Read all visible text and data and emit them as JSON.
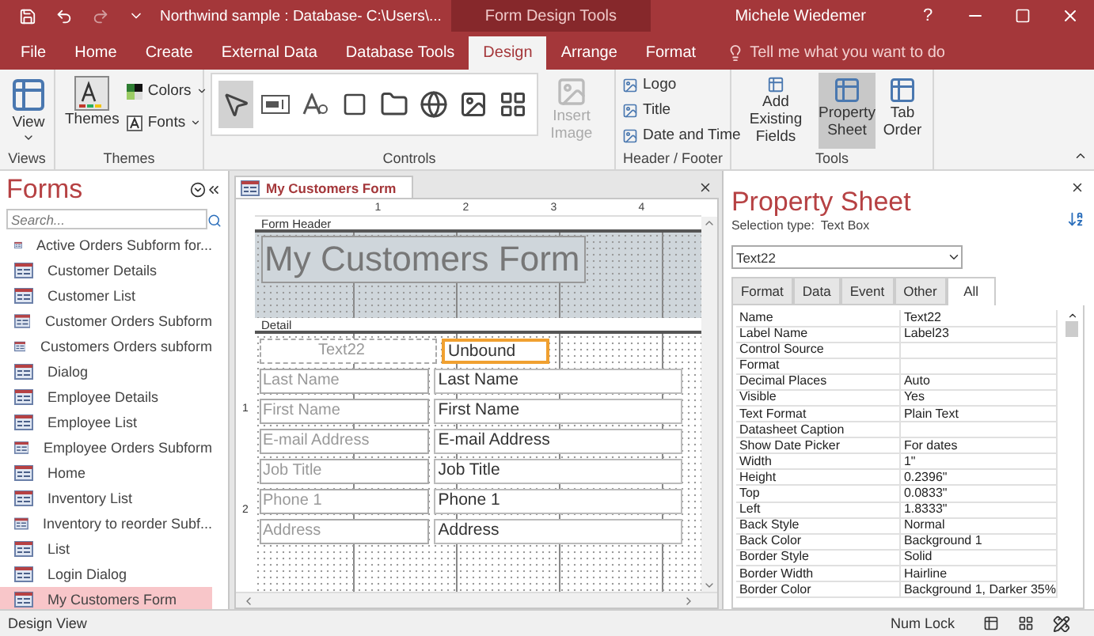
{
  "window": {
    "title": "Northwind sample : Database- C:\\Users\\...",
    "context_title": "Form Design Tools",
    "user": "Michele Wiedemer",
    "help": "?"
  },
  "ribbon_tabs": [
    {
      "label": "File",
      "selected": false
    },
    {
      "label": "Home",
      "selected": false
    },
    {
      "label": "Create",
      "selected": false
    },
    {
      "label": "External Data",
      "selected": false
    },
    {
      "label": "Database Tools",
      "selected": false
    },
    {
      "label": "Design",
      "selected": true
    },
    {
      "label": "Arrange",
      "selected": false
    },
    {
      "label": "Format",
      "selected": false
    }
  ],
  "tell_me": {
    "placeholder": "Tell me what you want to do"
  },
  "ribbon": {
    "views": {
      "label": "Views",
      "button": "View"
    },
    "themes": {
      "label": "Themes",
      "themes": "Themes",
      "colors": "Colors",
      "fonts": "Fonts"
    },
    "controls": {
      "label": "Controls",
      "insert_image": {
        "label": "Insert Image",
        "disabled": true
      }
    },
    "header_footer": {
      "label": "Header / Footer",
      "items": [
        "Logo",
        "Title",
        "Date and Time"
      ]
    },
    "tools": {
      "label": "Tools",
      "items": [
        {
          "label": "Add Existing Fields",
          "selected": false
        },
        {
          "label": "Property Sheet",
          "selected": true
        },
        {
          "label": "Tab Order",
          "selected": false
        }
      ]
    }
  },
  "nav": {
    "title": "Forms",
    "search": {
      "placeholder": "Search..."
    },
    "items": [
      {
        "label": "Active Orders Subform for...",
        "selected": false
      },
      {
        "label": "Customer Details",
        "selected": false
      },
      {
        "label": "Customer List",
        "selected": false
      },
      {
        "label": "Customer Orders Subform",
        "selected": false
      },
      {
        "label": "Customers Orders subform",
        "selected": false
      },
      {
        "label": "Dialog",
        "selected": false
      },
      {
        "label": "Employee Details",
        "selected": false
      },
      {
        "label": "Employee List",
        "selected": false
      },
      {
        "label": "Employee Orders Subform",
        "selected": false
      },
      {
        "label": "Home",
        "selected": false
      },
      {
        "label": "Inventory List",
        "selected": false
      },
      {
        "label": "Inventory to reorder Subf...",
        "selected": false
      },
      {
        "label": "List",
        "selected": false
      },
      {
        "label": "Login Dialog",
        "selected": false
      },
      {
        "label": "My Customers Form",
        "selected": true
      }
    ]
  },
  "document": {
    "tab": "My Customers Form",
    "ruler": [
      "1",
      "2",
      "3",
      "4"
    ],
    "vruler": [
      "1",
      "2"
    ],
    "form_header": {
      "section": "Form Header",
      "title": "My Customers Form"
    },
    "detail": {
      "section": "Detail",
      "controls": [
        {
          "label": "Text22",
          "value": "Unbound",
          "selected": true
        },
        {
          "label": "Last Name",
          "value": "Last Name",
          "selected": false
        },
        {
          "label": "First Name",
          "value": "First Name",
          "selected": false
        },
        {
          "label": "E-mail Address",
          "value": "E-mail Address",
          "selected": false
        },
        {
          "label": "Job Title",
          "value": "Job Title",
          "selected": false
        },
        {
          "label": "Phone 1",
          "value": "Phone 1",
          "selected": false
        },
        {
          "label": "Address",
          "value": "Address",
          "selected": false
        }
      ]
    }
  },
  "property_sheet": {
    "title": "Property Sheet",
    "selection_label": "Selection type:",
    "selection_type": "Text Box",
    "object": "Text22",
    "tabs": [
      {
        "label": "Format",
        "selected": false
      },
      {
        "label": "Data",
        "selected": false
      },
      {
        "label": "Event",
        "selected": false
      },
      {
        "label": "Other",
        "selected": false
      },
      {
        "label": "All",
        "selected": true
      }
    ],
    "rows": [
      {
        "name": "Name",
        "value": "Text22"
      },
      {
        "name": "Label Name",
        "value": "Label23"
      },
      {
        "name": "Control Source"
      },
      {
        "name": "Format"
      },
      {
        "name": "Decimal Places",
        "value": "Auto"
      },
      {
        "name": "Visible",
        "value": "Yes"
      },
      {
        "name": "Text Format",
        "value": "Plain Text"
      },
      {
        "name": "Datasheet Caption"
      },
      {
        "name": "Show Date Picker",
        "value": "For dates"
      },
      {
        "name": "Width",
        "value": "1\""
      },
      {
        "name": "Height",
        "value": "0.2396\""
      },
      {
        "name": "Top",
        "value": "0.0833\""
      },
      {
        "name": "Left",
        "value": "1.8333\""
      },
      {
        "name": "Back Style",
        "value": "Normal"
      },
      {
        "name": "Back Color",
        "value": "Background 1"
      },
      {
        "name": "Border Style",
        "value": "Solid"
      },
      {
        "name": "Border Width",
        "value": "Hairline"
      },
      {
        "name": "Border Color",
        "value": "Background 1, Darker 35%"
      }
    ]
  },
  "status_bar": {
    "left": "Design View",
    "num_lock": "Num Lock"
  }
}
